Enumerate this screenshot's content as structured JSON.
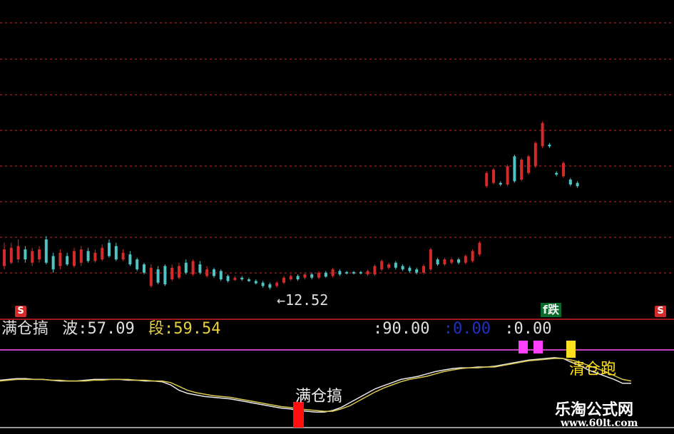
{
  "colors": {
    "background": "#000000",
    "up": "#d42a2a",
    "down": "#4fc4c4",
    "grid": "#8a1a1a",
    "divider": "#9a1a1a",
    "line_white": "#e8e8e8",
    "line_yellow": "#d8c850",
    "level_magenta": "#c040c0",
    "label_white": "#e0e0e0",
    "label_yellow": "#e8d040",
    "label_blue": "#2030c0",
    "marker_magenta": "#ff40ff",
    "marker_yellow": "#ffe020",
    "marker_red": "#ff1010"
  },
  "price_panel": {
    "low_annotation": "←12.52",
    "badge": "f跌",
    "s_marker_left": "S",
    "s_marker_right": "S"
  },
  "indicator_panel": {
    "name": "满仓搞",
    "wave_label": "波:",
    "wave_value": "57.09",
    "segment_label": "段:",
    "segment_value": "59.54",
    "level1": ":90.00",
    "level2": ":0.00",
    "level3": ":0.00",
    "buy_signal_text": "满仓搞",
    "sell_signal_text": "清仓跑"
  },
  "watermark": {
    "title": "乐淘公式网",
    "url": "www.60lt.com"
  },
  "chart_data": [
    {
      "type": "candlestick",
      "title": "",
      "low_marker": 12.52,
      "bars": [
        {
          "dir": "up",
          "o": 12.9,
          "c": 13.4,
          "h": 13.6,
          "l": 12.8
        },
        {
          "dir": "up",
          "o": 13.0,
          "c": 13.45,
          "h": 13.6,
          "l": 12.95
        },
        {
          "dir": "up",
          "o": 13.1,
          "c": 13.5,
          "h": 13.7,
          "l": 13.0
        },
        {
          "dir": "down",
          "o": 13.4,
          "c": 13.1,
          "h": 13.5,
          "l": 13.0
        },
        {
          "dir": "up",
          "o": 13.0,
          "c": 13.35,
          "h": 13.45,
          "l": 12.9
        },
        {
          "dir": "up",
          "o": 13.1,
          "c": 13.4,
          "h": 13.5,
          "l": 13.0
        },
        {
          "dir": "down",
          "o": 13.7,
          "c": 13.0,
          "h": 13.8,
          "l": 12.95
        },
        {
          "dir": "down",
          "o": 13.2,
          "c": 12.8,
          "h": 13.3,
          "l": 12.7
        },
        {
          "dir": "up",
          "o": 12.9,
          "c": 13.3,
          "h": 13.4,
          "l": 12.8
        },
        {
          "dir": "down",
          "o": 13.2,
          "c": 12.95,
          "h": 13.3,
          "l": 12.9
        },
        {
          "dir": "up",
          "o": 12.9,
          "c": 13.35,
          "h": 13.45,
          "l": 12.85
        },
        {
          "dir": "up",
          "o": 13.0,
          "c": 13.4,
          "h": 13.5,
          "l": 12.9
        },
        {
          "dir": "down",
          "o": 13.35,
          "c": 13.05,
          "h": 13.45,
          "l": 13.0
        },
        {
          "dir": "up",
          "o": 13.05,
          "c": 13.3,
          "h": 13.4,
          "l": 13.0
        },
        {
          "dir": "up",
          "o": 13.1,
          "c": 13.45,
          "h": 13.55,
          "l": 13.05
        },
        {
          "dir": "down",
          "o": 13.6,
          "c": 13.2,
          "h": 13.7,
          "l": 13.15
        },
        {
          "dir": "down",
          "o": 13.5,
          "c": 13.1,
          "h": 13.6,
          "l": 13.05
        },
        {
          "dir": "up",
          "o": 13.1,
          "c": 13.3,
          "h": 13.4,
          "l": 13.05
        },
        {
          "dir": "down",
          "o": 13.25,
          "c": 12.95,
          "h": 13.35,
          "l": 12.9
        },
        {
          "dir": "down",
          "o": 13.1,
          "c": 12.8,
          "h": 13.15,
          "l": 12.75
        },
        {
          "dir": "down",
          "o": 12.95,
          "c": 12.7,
          "h": 13.0,
          "l": 12.65
        },
        {
          "dir": "up",
          "o": 12.3,
          "c": 12.85,
          "h": 12.95,
          "l": 12.25
        },
        {
          "dir": "down",
          "o": 12.8,
          "c": 12.4,
          "h": 12.9,
          "l": 12.35
        },
        {
          "dir": "down",
          "o": 12.9,
          "c": 12.35,
          "h": 12.95,
          "l": 12.3
        },
        {
          "dir": "up",
          "o": 12.5,
          "c": 12.85,
          "h": 12.95,
          "l": 12.45
        },
        {
          "dir": "up",
          "o": 12.55,
          "c": 12.9,
          "h": 13.0,
          "l": 12.5
        },
        {
          "dir": "down",
          "o": 13.0,
          "c": 12.7,
          "h": 13.1,
          "l": 12.65
        },
        {
          "dir": "up",
          "o": 12.65,
          "c": 13.05,
          "h": 13.1,
          "l": 12.6
        },
        {
          "dir": "down",
          "o": 12.95,
          "c": 12.7,
          "h": 13.05,
          "l": 12.65
        },
        {
          "dir": "up",
          "o": 12.6,
          "c": 12.8,
          "h": 12.9,
          "l": 12.55
        },
        {
          "dir": "down",
          "o": 12.8,
          "c": 12.6,
          "h": 12.85,
          "l": 12.55
        },
        {
          "dir": "down",
          "o": 12.75,
          "c": 12.5,
          "h": 12.8,
          "l": 12.45
        },
        {
          "dir": "down",
          "o": 12.6,
          "c": 12.45,
          "h": 12.65,
          "l": 12.4
        },
        {
          "dir": "up",
          "o": 12.48,
          "c": 12.55,
          "h": 12.6,
          "l": 12.45
        },
        {
          "dir": "down",
          "o": 12.55,
          "c": 12.5,
          "h": 12.6,
          "l": 12.45
        },
        {
          "dir": "down",
          "o": 12.5,
          "c": 12.45,
          "h": 12.55,
          "l": 12.42
        },
        {
          "dir": "down",
          "o": 12.45,
          "c": 12.38,
          "h": 12.5,
          "l": 12.35
        },
        {
          "dir": "down",
          "o": 12.4,
          "c": 12.3,
          "h": 12.45,
          "l": 12.25
        },
        {
          "dir": "down",
          "o": 12.35,
          "c": 12.25,
          "h": 12.4,
          "l": 12.2
        },
        {
          "dir": "up",
          "o": 12.3,
          "c": 12.4,
          "h": 12.45,
          "l": 12.25
        },
        {
          "dir": "up",
          "o": 12.4,
          "c": 12.55,
          "h": 12.6,
          "l": 12.35
        },
        {
          "dir": "up",
          "o": 12.5,
          "c": 12.6,
          "h": 12.65,
          "l": 12.45
        },
        {
          "dir": "down",
          "o": 12.6,
          "c": 12.5,
          "h": 12.65,
          "l": 12.45
        },
        {
          "dir": "up",
          "o": 12.55,
          "c": 12.65,
          "h": 12.7,
          "l": 12.5
        },
        {
          "dir": "down",
          "o": 12.65,
          "c": 12.55,
          "h": 12.7,
          "l": 12.5
        },
        {
          "dir": "up",
          "o": 12.55,
          "c": 12.7,
          "h": 12.75,
          "l": 12.5
        },
        {
          "dir": "down",
          "o": 12.7,
          "c": 12.58,
          "h": 12.75,
          "l": 12.55
        },
        {
          "dir": "up",
          "o": 12.6,
          "c": 12.8,
          "h": 12.85,
          "l": 12.55
        },
        {
          "dir": "down",
          "o": 12.75,
          "c": 12.65,
          "h": 12.8,
          "l": 12.6
        },
        {
          "dir": "down",
          "o": 12.72,
          "c": 12.68,
          "h": 12.75,
          "l": 12.65
        },
        {
          "dir": "down",
          "o": 12.72,
          "c": 12.68,
          "h": 12.75,
          "l": 12.65
        },
        {
          "dir": "down",
          "o": 12.72,
          "c": 12.68,
          "h": 12.75,
          "l": 12.65
        },
        {
          "dir": "up",
          "o": 12.65,
          "c": 12.75,
          "h": 12.8,
          "l": 12.6
        },
        {
          "dir": "up",
          "o": 12.65,
          "c": 12.9,
          "h": 12.95,
          "l": 12.6
        },
        {
          "dir": "up",
          "o": 12.8,
          "c": 13.05,
          "h": 13.1,
          "l": 12.75
        },
        {
          "dir": "up",
          "o": 12.85,
          "c": 12.95,
          "h": 13.0,
          "l": 12.8
        },
        {
          "dir": "down",
          "o": 13.0,
          "c": 12.85,
          "h": 13.05,
          "l": 12.8
        },
        {
          "dir": "down",
          "o": 12.9,
          "c": 12.8,
          "h": 12.95,
          "l": 12.75
        },
        {
          "dir": "down",
          "o": 12.85,
          "c": 12.75,
          "h": 12.9,
          "l": 12.7
        },
        {
          "dir": "down",
          "o": 12.8,
          "c": 12.7,
          "h": 12.85,
          "l": 12.65
        },
        {
          "dir": "up",
          "o": 12.7,
          "c": 12.9,
          "h": 12.95,
          "l": 12.65
        },
        {
          "dir": "up",
          "o": 12.8,
          "c": 13.4,
          "h": 13.45,
          "l": 12.75
        },
        {
          "dir": "down",
          "o": 13.1,
          "c": 12.95,
          "h": 13.15,
          "l": 12.9
        },
        {
          "dir": "up",
          "o": 12.95,
          "c": 13.1,
          "h": 13.15,
          "l": 12.9
        },
        {
          "dir": "up",
          "o": 13.0,
          "c": 13.1,
          "h": 13.15,
          "l": 12.95
        },
        {
          "dir": "down",
          "o": 13.1,
          "c": 13.0,
          "h": 13.15,
          "l": 12.95
        },
        {
          "dir": "up",
          "o": 13.0,
          "c": 13.2,
          "h": 13.25,
          "l": 12.95
        },
        {
          "dir": "up",
          "o": 13.05,
          "c": 13.35,
          "h": 13.4,
          "l": 13.0
        },
        {
          "dir": "up",
          "o": 13.25,
          "c": 13.6,
          "h": 13.65,
          "l": 13.2
        },
        {
          "dir": "up",
          "o": 15.3,
          "c": 15.7,
          "h": 15.75,
          "l": 15.25
        },
        {
          "dir": "up",
          "o": 15.4,
          "c": 15.8,
          "h": 15.85,
          "l": 15.35
        },
        {
          "dir": "down",
          "o": 15.4,
          "c": 15.35,
          "h": 15.45,
          "l": 15.3
        },
        {
          "dir": "up",
          "o": 15.35,
          "c": 15.9,
          "h": 15.95,
          "l": 15.3
        },
        {
          "dir": "down",
          "o": 16.2,
          "c": 15.45,
          "h": 16.25,
          "l": 15.4
        },
        {
          "dir": "up",
          "o": 15.5,
          "c": 16.1,
          "h": 16.15,
          "l": 15.45
        },
        {
          "dir": "up",
          "o": 15.7,
          "c": 16.2,
          "h": 16.25,
          "l": 15.65
        },
        {
          "dir": "up",
          "o": 15.9,
          "c": 16.6,
          "h": 16.65,
          "l": 15.85
        },
        {
          "dir": "up",
          "o": 16.5,
          "c": 17.2,
          "h": 17.25,
          "l": 16.45
        },
        {
          "dir": "down",
          "o": 16.55,
          "c": 16.5,
          "h": 16.6,
          "l": 16.45
        },
        {
          "dir": "down",
          "o": 15.7,
          "c": 15.65,
          "h": 15.75,
          "l": 15.6
        },
        {
          "dir": "up",
          "o": 15.6,
          "c": 16.0,
          "h": 16.05,
          "l": 15.55
        },
        {
          "dir": "down",
          "o": 15.5,
          "c": 15.35,
          "h": 15.55,
          "l": 15.3
        },
        {
          "dir": "down",
          "o": 15.4,
          "c": 15.3,
          "h": 15.45,
          "l": 15.25
        }
      ]
    },
    {
      "type": "line",
      "title": "满仓搞",
      "ylim": [
        0,
        100
      ],
      "levels": [
        90.0,
        0.0,
        0.0
      ],
      "series": [
        {
          "name": "波",
          "last": 57.09,
          "values": [
            61,
            62,
            63,
            63,
            62,
            62,
            61,
            60,
            60,
            60,
            61,
            62,
            62,
            62,
            62,
            61,
            61,
            60,
            60,
            59,
            55,
            48,
            44,
            42,
            40,
            39,
            38,
            37,
            35,
            33,
            31,
            29,
            27,
            25,
            24,
            22,
            21,
            20,
            20,
            22,
            26,
            32,
            38,
            44,
            50,
            54,
            58,
            62,
            64,
            66,
            69,
            72,
            74,
            76,
            77,
            77,
            78,
            78,
            79,
            81,
            83,
            85,
            87,
            88,
            89,
            90,
            89,
            84,
            80,
            74,
            70,
            66,
            62,
            57,
            57
          ]
        },
        {
          "name": "段",
          "last": 59.54,
          "values": [
            60,
            61,
            62,
            62,
            62,
            62,
            61,
            61,
            60,
            60,
            60,
            61,
            61,
            62,
            62,
            62,
            61,
            61,
            60,
            60,
            58,
            53,
            48,
            45,
            43,
            41,
            40,
            39,
            37,
            35,
            33,
            31,
            29,
            27,
            26,
            24,
            23,
            22,
            21,
            21,
            24,
            28,
            34,
            40,
            46,
            51,
            55,
            59,
            62,
            64,
            66,
            69,
            72,
            74,
            76,
            77,
            77,
            78,
            78,
            80,
            82,
            84,
            86,
            87,
            88,
            89,
            89,
            87,
            84,
            80,
            76,
            72,
            67,
            62,
            60
          ]
        }
      ],
      "signals": [
        {
          "label": "满仓搞",
          "kind": "buy",
          "x_index": 38
        },
        {
          "label": "清仓跑",
          "kind": "sell",
          "x_index": 66
        }
      ]
    }
  ]
}
